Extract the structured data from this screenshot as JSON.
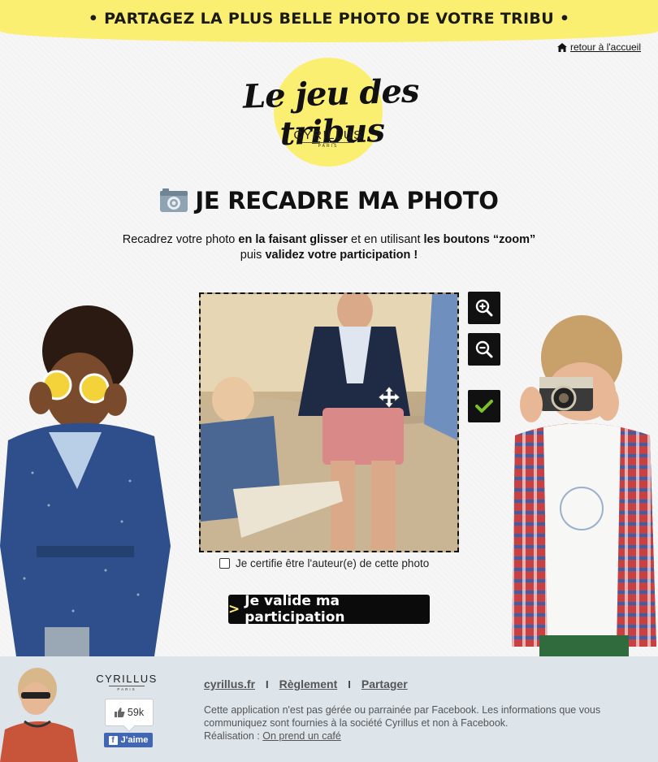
{
  "banner": {
    "text": "• PARTAGEZ LA PLUS BELLE PHOTO DE VOTRE TRIBU •"
  },
  "nav": {
    "home_label": "retour à l'accueil"
  },
  "logo": {
    "script": "Le jeu des tribus",
    "brand": "CYRILLUS",
    "city": "PARIS"
  },
  "title": "JE RECADRE MA PHOTO",
  "instructions": {
    "p1_a": "Recadrez votre photo ",
    "p1_b": "en la faisant glisser",
    "p1_c": " et en utilisant ",
    "p1_d": "les boutons “zoom”",
    "p2_a": "puis ",
    "p2_b": "validez votre participation !"
  },
  "tools": {
    "zoom_in": "zoom-in",
    "zoom_out": "zoom-out",
    "validate": "check"
  },
  "certify": {
    "label": "Je certifie être l'auteur(e) de cette photo",
    "checked": false
  },
  "submit": {
    "arrow": ">",
    "label": "Je valide ma participation"
  },
  "footer": {
    "brand": "CYRILLUS",
    "city": "PARIS",
    "likes": "59k",
    "like_label": "J'aime",
    "links": [
      "cyrillus.fr",
      "Règlement",
      "Partager"
    ],
    "separator": "I",
    "disclaimer_1": "Cette application n'est pas gérée ou parrainée par Facebook. Les informations que vous communiquez sont fournies à la société Cyrillus et non à Facebook.",
    "credit_prefix": "Réalisation : ",
    "credit_link": "On prend un café"
  },
  "colors": {
    "accent_yellow": "#fbef72",
    "button_black": "#0b0b0b",
    "check_green": "#7ac12b",
    "facebook_blue": "#4267b2"
  }
}
